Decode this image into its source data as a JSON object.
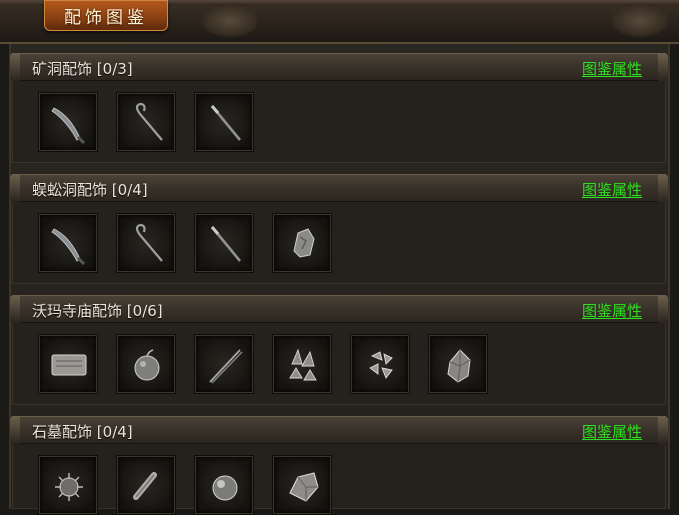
{
  "window": {
    "title": "配饰图鉴"
  },
  "sections": [
    {
      "title": "矿洞配饰",
      "count": "[0/3]",
      "link": "图鉴属性",
      "items": [
        "blade-icon",
        "crook-staff-icon",
        "rod-icon"
      ]
    },
    {
      "title": "蜈蚣洞配饰",
      "count": "[0/4]",
      "link": "图鉴属性",
      "items": [
        "blade-icon",
        "crook-staff-icon",
        "rod-icon",
        "ore-fragment-icon"
      ]
    },
    {
      "title": "沃玛寺庙配饰",
      "count": "[0/6]",
      "link": "图鉴属性",
      "items": [
        "brick-icon",
        "apple-icon",
        "chopsticks-icon",
        "crystal-cluster-icon",
        "shard-cluster-icon",
        "gem-pouch-icon"
      ]
    },
    {
      "title": "石墓配饰",
      "count": "[0/4]",
      "link": "图鉴属性",
      "items": [
        "spiky-orb-icon",
        "scroll-icon",
        "glass-orb-icon",
        "crystal-chunk-icon"
      ]
    }
  ],
  "colors": {
    "link": "#2ee21f",
    "title_tab": "#a04a16",
    "panel": "#25221d"
  }
}
